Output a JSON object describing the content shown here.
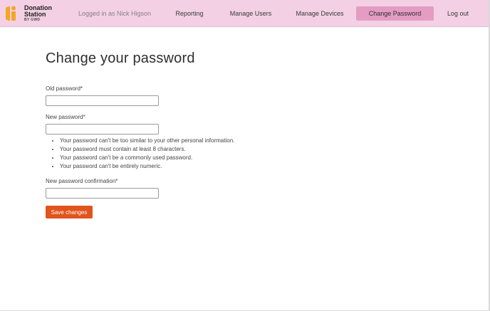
{
  "brand": {
    "name_line1": "Donation",
    "name_line2": "Station",
    "sub": "BY GWD",
    "logo_icon": "donation-station-logo-icon",
    "colors": {
      "header_bg": "#f3d0e4",
      "active_nav": "#e49cc4",
      "button": "#e1541b",
      "logo_orange": "#f5a623"
    }
  },
  "header": {
    "logged_in": "Logged in as Nick Higson",
    "nav": {
      "reporting": "Reporting",
      "manage_users": "Manage Users",
      "manage_devices": "Manage Devices",
      "change_password": "Change Password",
      "logout": "Log out"
    },
    "active": "change_password"
  },
  "form": {
    "title": "Change your password",
    "old_password": {
      "label": "Old password*",
      "value": "",
      "placeholder": ""
    },
    "new_password": {
      "label": "New password*",
      "value": "",
      "placeholder": ""
    },
    "help_items": [
      "Your password can't be too similar to your other personal information.",
      "Your password must contain at least 8 characters.",
      "Your password can't be a commonly used password.",
      "Your password can't be entirely numeric."
    ],
    "confirm_password": {
      "label": "New password confirmation*",
      "value": "",
      "placeholder": ""
    },
    "submit_label": "Save changes"
  }
}
